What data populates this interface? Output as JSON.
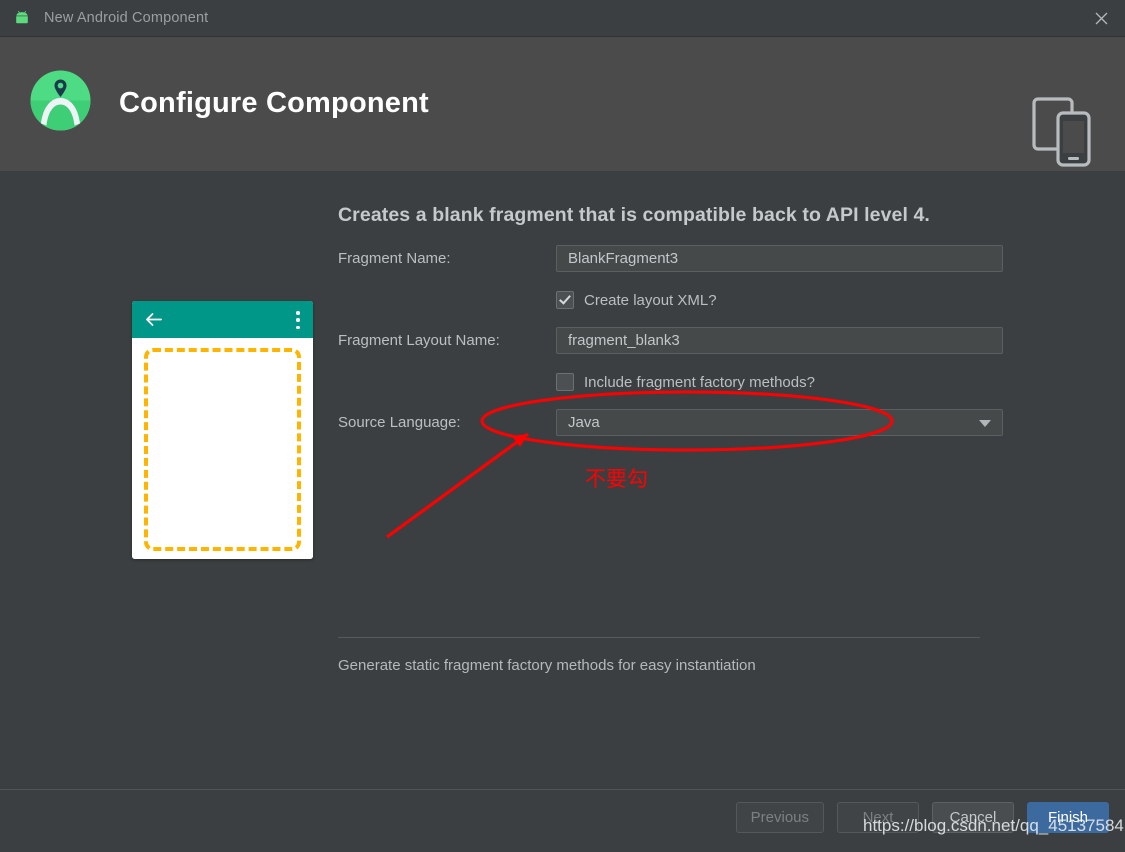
{
  "window": {
    "title": "New Android Component",
    "app_icon": "android-robot-icon",
    "close_icon": "close-icon"
  },
  "header": {
    "title": "Configure Component",
    "logo_icon": "android-studio-logo-icon",
    "device_icon": "tablet-and-phone-icon",
    "background": "#4b4b4b"
  },
  "preview": {
    "appbar_color": "#009688",
    "back_icon": "arrow-back-icon",
    "overflow_icon": "overflow-menu-icon",
    "placeholder_color": "#ffb400"
  },
  "main": {
    "description": "Creates a blank fragment that is compatible back to API level 4.",
    "fields": [
      {
        "label": "Fragment Name:",
        "value": "BlankFragment3",
        "type": "text"
      },
      {
        "label": "Fragment Layout Name:",
        "value": "fragment_blank3",
        "type": "text"
      },
      {
        "label": "Source Language:",
        "value": "Java",
        "type": "combo"
      }
    ],
    "checkboxes": [
      {
        "label": "Create layout XML?",
        "checked": true
      },
      {
        "label": "Include fragment factory methods?",
        "checked": false
      }
    ],
    "hint": "Generate static fragment factory methods for easy instantiation"
  },
  "footer": {
    "buttons": [
      {
        "label": "Previous",
        "state": "disabled"
      },
      {
        "label": "Next",
        "state": "disabled"
      },
      {
        "label": "Cancel",
        "state": "normal"
      },
      {
        "label": "Finish",
        "state": "primary"
      }
    ],
    "primary_color": "#3c6a9e"
  },
  "annotations": {
    "note_text": "不要勾",
    "color": "#ff0000"
  },
  "watermark": {
    "text": "https://blog.csdn.net/qq_45137584"
  }
}
